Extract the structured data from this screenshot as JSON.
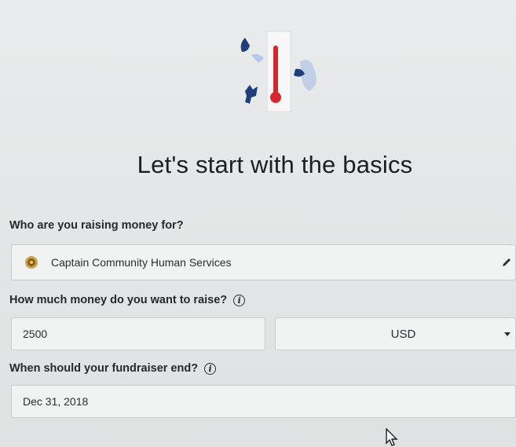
{
  "page": {
    "heading": "Let's start with the basics"
  },
  "illustration": {
    "icon": "thermometer-goal-illustration",
    "accent_color": "#d4262e",
    "figure_color": "#1f3f7a"
  },
  "fields": {
    "organization": {
      "label": "Who are you raising money for?",
      "value": "Captain Community Human Services",
      "badge_icon": "organization-seal-icon",
      "edit_icon": "pencil-icon"
    },
    "goal": {
      "label": "How much money do you want to raise?",
      "info_icon": "info-icon",
      "amount_value": "2500",
      "currency_value": "USD",
      "currency_icon": "chevron-down-icon"
    },
    "end_date": {
      "label": "When should your fundraiser end?",
      "info_icon": "info-icon",
      "value": "Dec 31, 2018"
    }
  },
  "info_glyph": "i",
  "cursor": {
    "icon": "mouse-pointer-icon"
  }
}
